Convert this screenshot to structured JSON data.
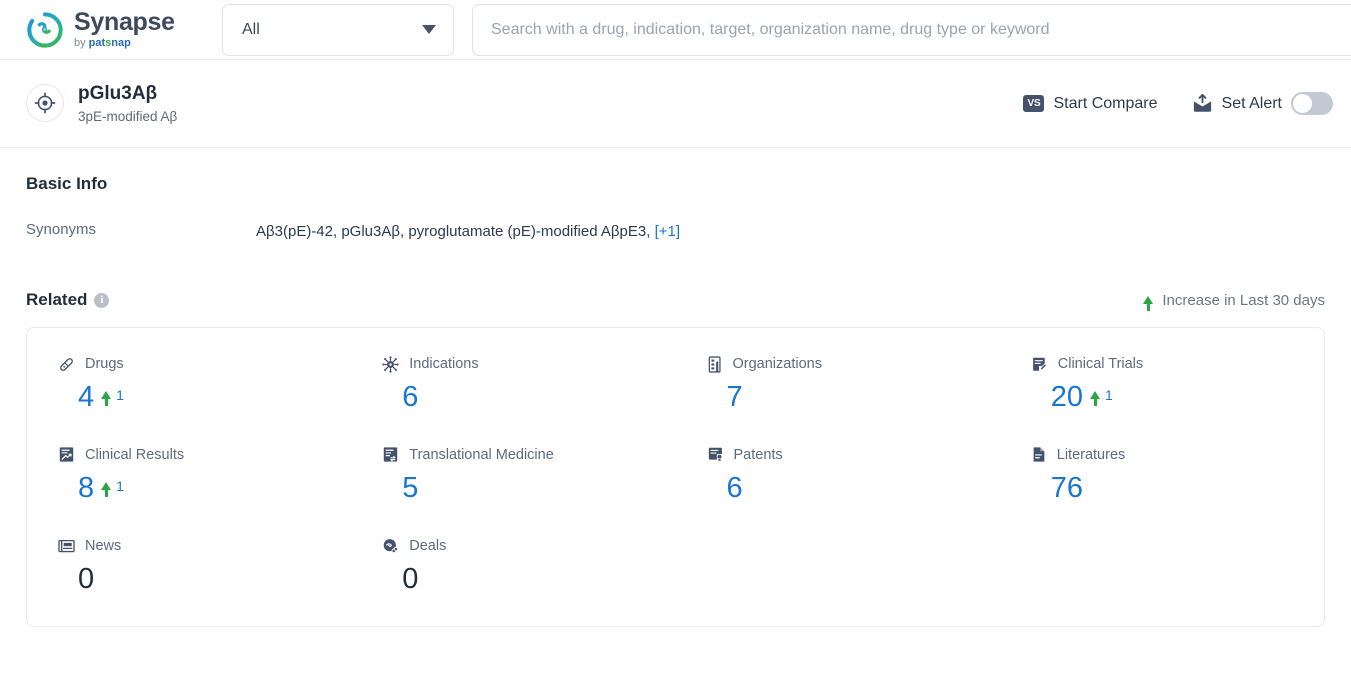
{
  "header": {
    "brand": {
      "name": "Synapse",
      "by": "by",
      "pat": "pat",
      "snap_s": "s",
      "snap_rest": "nap"
    },
    "scope": {
      "value": "All",
      "caret_icon": "chevron-down-icon"
    },
    "search": {
      "value": "",
      "placeholder": "Search with a drug, indication, target, organization name, drug type or keyword"
    }
  },
  "entity": {
    "avatar_icon": "target-crosshair-icon",
    "name": "pGlu3Aβ",
    "alias": "3pE-modified Aβ",
    "compare": {
      "label": "Start Compare",
      "badge": "VS"
    },
    "alert": {
      "label": "Set Alert",
      "icon": "alert-bell-icon",
      "toggle_on": false
    }
  },
  "basic_info": {
    "title": "Basic Info",
    "synonyms_label": "Synonyms",
    "synonyms_value": "Aβ3(pE)-42, pGlu3Aβ, pyroglutamate (pE)-modified AβpE3,",
    "synonyms_more": "[+1]"
  },
  "related": {
    "title": "Related",
    "info_icon": "info-circle-icon",
    "info_glyph": "i",
    "legend_label": "Increase in Last 30 days",
    "legend_icon": "arrow-up-icon",
    "accent_blue": "#1876d1",
    "accent_green": "#29a745",
    "items": [
      {
        "label": "Drugs",
        "icon": "pill-capsule-icon",
        "value": "4",
        "delta": "1",
        "is_zero": false
      },
      {
        "label": "Indications",
        "icon": "virus-icon",
        "value": "6",
        "delta": null,
        "is_zero": false
      },
      {
        "label": "Organizations",
        "icon": "building-icon",
        "value": "7",
        "delta": null,
        "is_zero": false
      },
      {
        "label": "Clinical Trials",
        "icon": "clipboard-pen-icon",
        "value": "20",
        "delta": "1",
        "is_zero": false
      },
      {
        "label": "Clinical Results",
        "icon": "doc-chart-icon",
        "value": "8",
        "delta": "1",
        "is_zero": false
      },
      {
        "label": "Translational Medicine",
        "icon": "doc-exchange-icon",
        "value": "5",
        "delta": null,
        "is_zero": false
      },
      {
        "label": "Patents",
        "icon": "patent-seal-icon",
        "value": "6",
        "delta": null,
        "is_zero": false
      },
      {
        "label": "Literatures",
        "icon": "literature-doc-icon",
        "value": "76",
        "delta": null,
        "is_zero": false
      },
      {
        "label": "News",
        "icon": "newspaper-icon",
        "value": "0",
        "delta": null,
        "is_zero": true
      },
      {
        "label": "Deals",
        "icon": "handshake-deal-icon",
        "value": "0",
        "delta": null,
        "is_zero": true
      }
    ]
  }
}
